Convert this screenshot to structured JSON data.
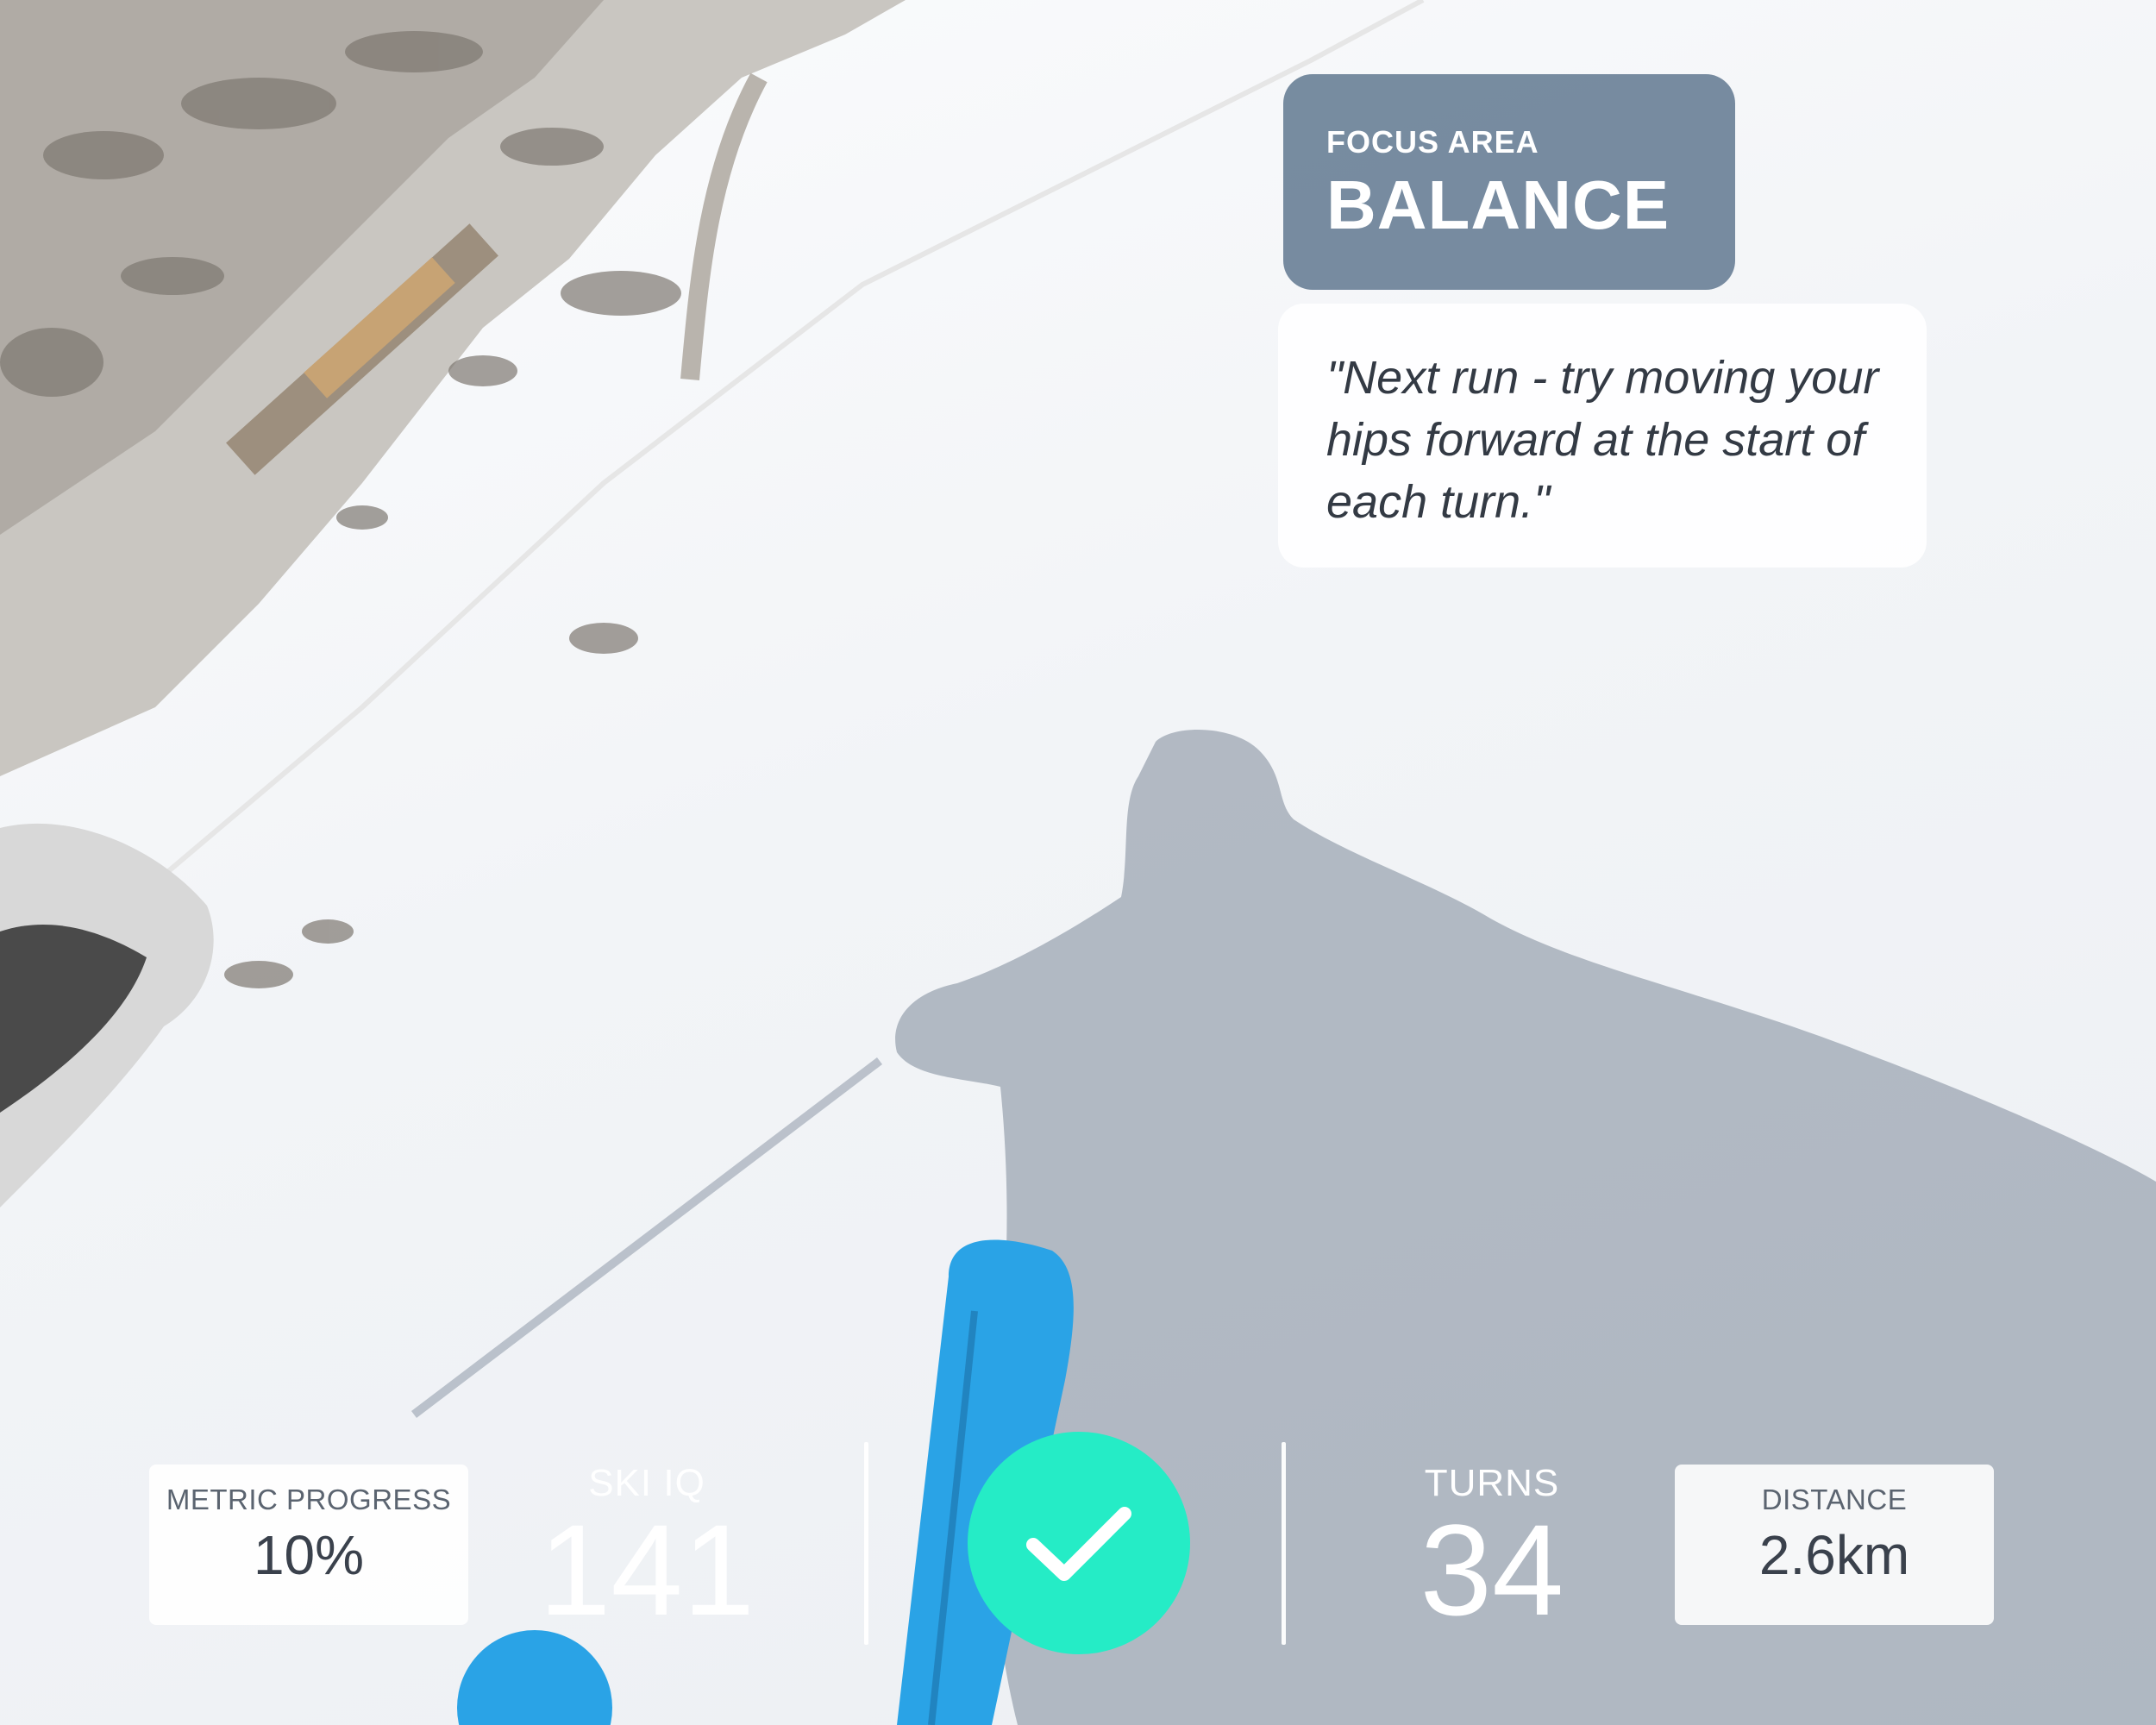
{
  "focus_area": {
    "label": "FOCUS AREA",
    "value": "BALANCE"
  },
  "tip": {
    "text": "\"Next run - try moving your hips forward at the start of each turn.\""
  },
  "stats": {
    "metric_progress": {
      "label": "METRIC PROGRESS",
      "value": "10%"
    },
    "ski_iq": {
      "label": "SKI IQ",
      "value": "141"
    },
    "turns": {
      "label": "TURNS",
      "value": "34"
    },
    "distance": {
      "label": "DISTANCE",
      "value": "2.6km"
    }
  },
  "icons": {
    "confirm": "check-icon"
  },
  "colors": {
    "focus_card_bg": "#657c93",
    "confirm_button": "#25ecc6",
    "ski_blue": "#2aa3e6"
  }
}
